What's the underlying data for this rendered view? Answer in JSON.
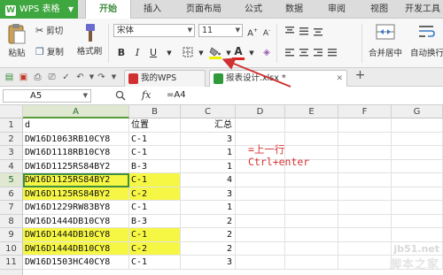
{
  "menubar": {
    "app_name": "WPS 表格",
    "tabs": [
      "开始",
      "插入",
      "页面布局",
      "公式",
      "数据",
      "审阅",
      "视图",
      "开发工具"
    ]
  },
  "ribbon": {
    "paste_label": "粘贴",
    "cut_label": "剪切",
    "copy_label": "复制",
    "format_painter_label": "格式刷",
    "font_name": "宋体",
    "font_size": "11",
    "bold_label": "B",
    "italic_label": "I",
    "underline_label": "U",
    "font_color_label": "A",
    "merge_label": "合并居中",
    "wrap_label": "自动换行",
    "fill_color": "#f2f200",
    "font_color": "#e02020"
  },
  "tabbar": {
    "doc_tabs": [
      {
        "label": "我的WPS"
      },
      {
        "label": "报表设计.xlsx *"
      }
    ],
    "add_label": "+"
  },
  "formula_bar": {
    "cell_ref": "A5",
    "fx_label": "fx",
    "formula": "=A4"
  },
  "sheet": {
    "columns": [
      "A",
      "B",
      "C",
      "D",
      "E",
      "F",
      "G"
    ],
    "rows": [
      {
        "num": "1",
        "a": "d",
        "b": "位置",
        "c": "汇总",
        "hl": false
      },
      {
        "num": "2",
        "a": "DW16D1063RB10CY8",
        "b": "C-1",
        "c": "3",
        "hl": false
      },
      {
        "num": "3",
        "a": "DW16D1118RB10CY8",
        "b": "C-1",
        "c": "1",
        "hl": false
      },
      {
        "num": "4",
        "a": "DW16D1125RS84BY2",
        "b": "B-3",
        "c": "1",
        "hl": false
      },
      {
        "num": "5",
        "a": "DW16D1125RS84BY2",
        "b": "C-1",
        "c": "4",
        "hl": true
      },
      {
        "num": "6",
        "a": "DW16D1125RS84BY2",
        "b": "C-2",
        "c": "3",
        "hl": true
      },
      {
        "num": "7",
        "a": "DW16D1229RW83BY8",
        "b": "C-1",
        "c": "1",
        "hl": false
      },
      {
        "num": "8",
        "a": "DW16D1444DB10CY8",
        "b": "B-3",
        "c": "2",
        "hl": false
      },
      {
        "num": "9",
        "a": "DW16D1444DB10CY8",
        "b": "C-1",
        "c": "2",
        "hl": true
      },
      {
        "num": "10",
        "a": "DW16D1444DB10CY8",
        "b": "C-2",
        "c": "2",
        "hl": true
      },
      {
        "num": "11",
        "a": "DW16D1503HC40CY8",
        "b": "C-1",
        "c": "3",
        "hl": false
      }
    ],
    "active_cell": "A5",
    "highlight_color": "#f6f744"
  },
  "annotation": {
    "line1": "=上一行",
    "line2": "Ctrl+enter",
    "color": "#d83434"
  },
  "watermark": {
    "line1": "jb51.net",
    "line2": "脚本之家"
  }
}
